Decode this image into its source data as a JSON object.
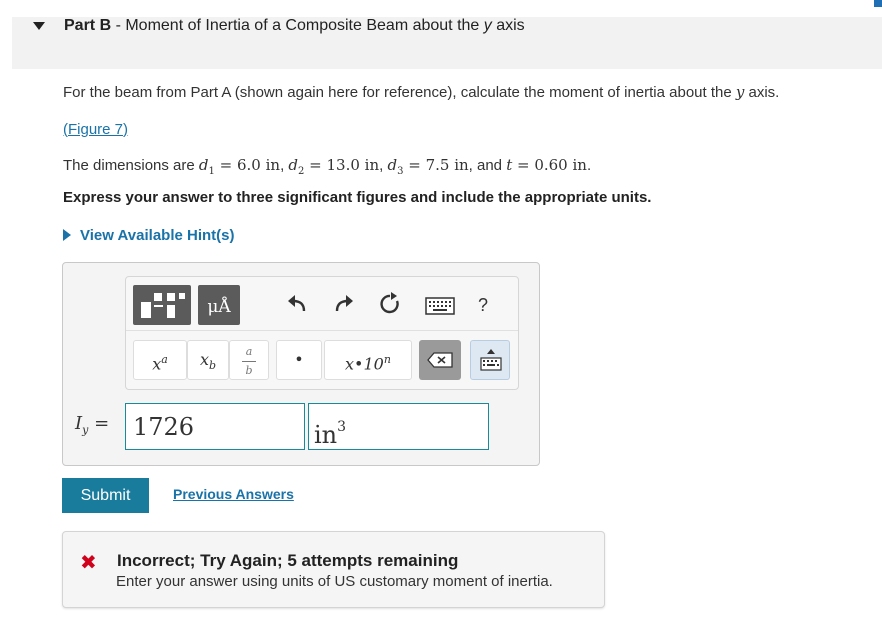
{
  "part": {
    "label": "Part B",
    "separator": " - ",
    "title_prefix": "Moment of Inertia of a Composite Beam about the ",
    "title_var": "y",
    "title_suffix": " axis"
  },
  "prompt": {
    "line1_text": "For the beam from Part A (shown again here for reference), calculate the moment of inertia about the ",
    "line1_var": "y",
    "line1_end": " axis.",
    "figure_link_open": "(",
    "figure_link": "Figure 7",
    "figure_link_close": ")",
    "dims_prefix": "The dimensions are ",
    "d1_var": "d",
    "d1_sub": "1",
    "d1_val": " = 6.0 in",
    "d2_var": "d",
    "d2_sub": "2",
    "d2_val": " = 13.0 in",
    "d3_var": "d",
    "d3_sub": "3",
    "d3_val": " = 7.5 in",
    "and_text": ", and ",
    "t_var": "t",
    "t_val": " = 0.60 in",
    "comma": ", ",
    "period": ".",
    "instructions": "Express your answer to three significant figures and include the appropriate units.",
    "hint_label": "View Available Hint(s)"
  },
  "toolbar": {
    "icons": [
      "templates-icon",
      "units-icon",
      "undo-icon",
      "redo-icon",
      "reset-icon",
      "keyboard-icon",
      "help-icon"
    ],
    "units_glyph": "μÅ",
    "help_glyph": "?",
    "keys": {
      "superscript": "x",
      "superscript_exp": "a",
      "subscript": "x",
      "subscript_sub": "b",
      "fraction_num": "a",
      "fraction_den": "b",
      "dot": "•",
      "sci_notation": "x•10",
      "sci_exp": "n"
    }
  },
  "answer": {
    "label_var": "I",
    "label_sub": "y",
    "equals": " =",
    "value": "1726",
    "units": "in",
    "units_exp": "3"
  },
  "actions": {
    "submit": "Submit",
    "previous_answers": "Previous Answers"
  },
  "feedback": {
    "icon": "✖",
    "title": "Incorrect; Try Again; 5 attempts remaining",
    "message": "Enter your answer using units of US customary moment of inertia."
  },
  "colors": {
    "link": "#1a73a8",
    "submit_bg": "#1a7c9c",
    "input_border": "#1a8a9a",
    "error": "#d0021b"
  }
}
